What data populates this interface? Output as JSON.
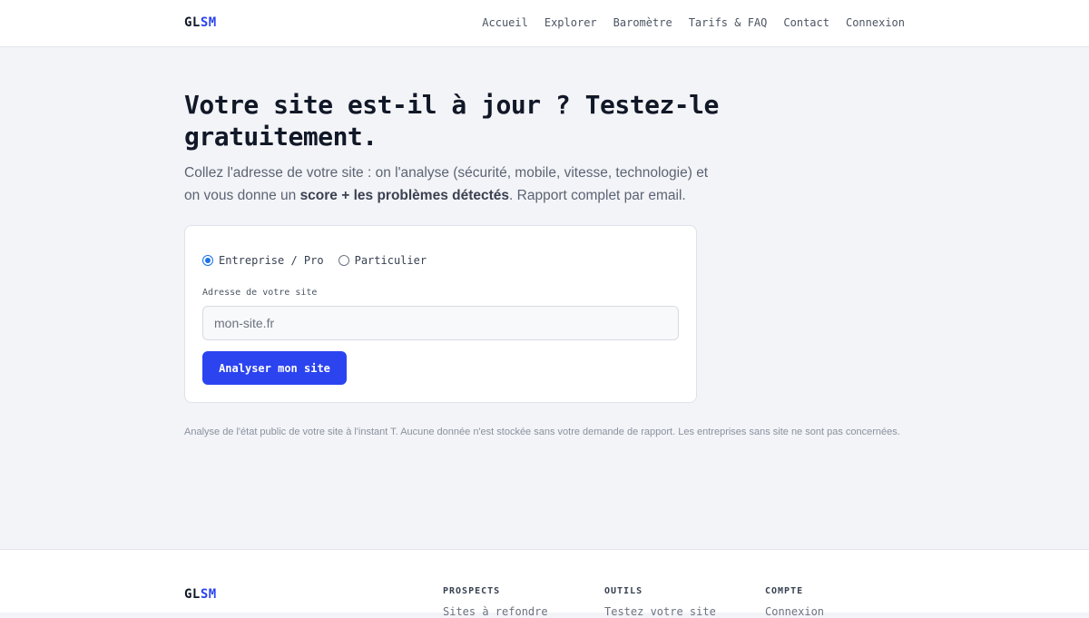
{
  "header": {
    "logo_primary": "GL",
    "logo_accent": "SM",
    "nav": [
      "Accueil",
      "Explorer",
      "Baromètre",
      "Tarifs & FAQ",
      "Contact",
      "Connexion"
    ]
  },
  "hero": {
    "title": "Votre site est-il à jour ? Testez-le gratuitement.",
    "subtitle_before": "Collez l'adresse de votre site : on l'analyse (sécurité, mobile, vitesse, technologie) et on vous donne un ",
    "subtitle_bold": "score + les problèmes détectés",
    "subtitle_after": ". Rapport complet par email."
  },
  "form": {
    "options": [
      {
        "label": "Entreprise / Pro",
        "checked": true
      },
      {
        "label": "Particulier",
        "checked": false
      }
    ],
    "field_label": "Adresse de votre site",
    "input_placeholder": "mon-site.fr",
    "input_value": "",
    "submit_label": "Analyser mon site"
  },
  "disclaimer": "Analyse de l'état public de votre site à l'instant T. Aucune donnée n'est stockée sans votre demande de rapport. Les entreprises sans site ne sont pas concernées.",
  "footer": {
    "logo_primary": "GL",
    "logo_accent": "SM",
    "columns": [
      {
        "heading": "PROSPECTS",
        "first_link": "Sites à refondre"
      },
      {
        "heading": "OUTILS",
        "first_link": "Testez votre site"
      },
      {
        "heading": "COMPTE",
        "first_link": "Connexion"
      }
    ]
  },
  "colors": {
    "accent": "#2b44f0",
    "background": "#f3f4f8",
    "radio_checked": "#1a73e8"
  }
}
